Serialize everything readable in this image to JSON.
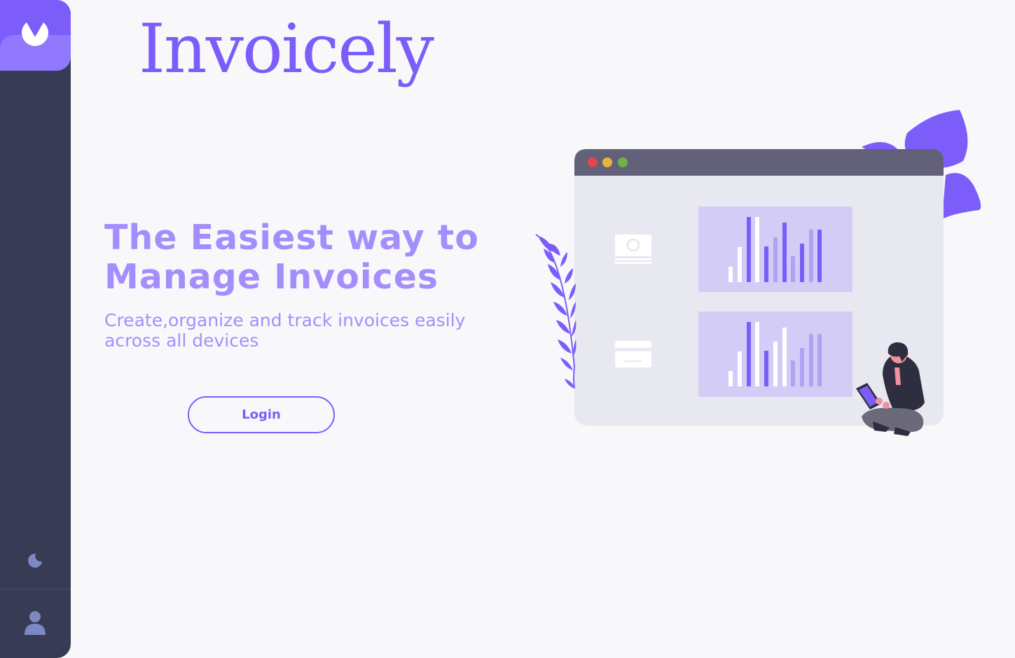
{
  "app": {
    "brand_name": "Invoicely"
  },
  "sidebar": {
    "logo_icon": "app-logo-icon",
    "theme_icon": "moon-icon",
    "user_icon": "user-avatar-icon"
  },
  "hero": {
    "headline_line1": "The Easiest way to",
    "headline_line2": "Manage Invoices",
    "subtext_line1": "Create,organize and track invoices easily",
    "subtext_line2": "across all devices",
    "login_label": "Login"
  },
  "illustration": {
    "window_dot_colors": [
      "#e0484c",
      "#e7b53a",
      "#6fb347"
    ],
    "left_icons": [
      "banknote-icon",
      "credit-card-icon"
    ],
    "accent_color": "#7c5dfa",
    "panel_color": "#d3ccf7"
  },
  "colors": {
    "sidebar": "#373b53",
    "accent": "#7c5dfa",
    "accent_light": "#9277ff",
    "headline": "#a48efc",
    "background": "#f8f8fb"
  }
}
